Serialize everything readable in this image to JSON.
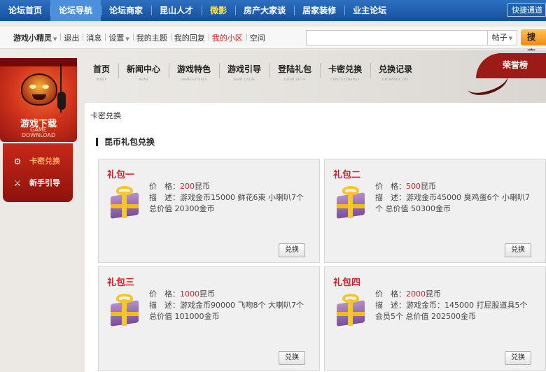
{
  "topnav": {
    "items": [
      "论坛首页",
      "论坛导航",
      "论坛商家",
      "昆山人才",
      "微影",
      "房产大家谈",
      "居家装修",
      "业主论坛"
    ],
    "quick": "快捷通道"
  },
  "userbar": {
    "username": "游戏小精灵",
    "logout": "退出",
    "messages": "消息",
    "settings": "设置",
    "my_threads": "我的主题",
    "my_replies": "我的回复",
    "my_community": "我的小区",
    "space": "空间"
  },
  "search": {
    "placeholder": "",
    "type_label": "帖子",
    "button_label": "搜 索"
  },
  "game_nav": [
    {
      "cn": "首页",
      "en": "INDEX"
    },
    {
      "cn": "新闻中心",
      "en": "NEWS"
    },
    {
      "cn": "游戏特色",
      "en": "GAMEFEATURES"
    },
    {
      "cn": "游戏引导",
      "en": "GAME GUIDE"
    },
    {
      "cn": "登陆礼包",
      "en": "LOGIN GIFTS"
    },
    {
      "cn": "卡密兑换",
      "en": "CARD EXCHANGE"
    },
    {
      "cn": "兑换记录",
      "en": "EXCHANGE LOG"
    }
  ],
  "honor_label": "荣誉榜",
  "left": {
    "download_cn": "游戏下载",
    "download_en_1": "GAME",
    "download_en_2": "DOWNLOAD",
    "menu": [
      {
        "label": "卡密兑换",
        "icon": "gear-icon"
      },
      {
        "label": "新手引导",
        "icon": "sword-icon"
      }
    ]
  },
  "main": {
    "breadcrumb": "卡密兑换",
    "section_title": "昆币礼包兑换",
    "price_label": "价　格：",
    "desc_label": "描　述：",
    "currency": "昆币",
    "redeem_label": "兑换",
    "gifts": [
      {
        "title": "礼包一",
        "price": "200",
        "desc": "游戏金币15000 鲜花6束 小喇叭7个 总价值 20300金币"
      },
      {
        "title": "礼包二",
        "price": "500",
        "desc": "游戏金币45000 臭鸡蛋6个 小喇叭7个 总价值 50300金币"
      },
      {
        "title": "礼包三",
        "price": "1000",
        "desc": "游戏金币90000 飞吻8个 大喇叭7个 总价值 101000金币"
      },
      {
        "title": "礼包四",
        "price": "2000",
        "desc": "游戏金币：145000 打屁股道具5个 会员5个 总价值 202500金币"
      }
    ]
  }
}
